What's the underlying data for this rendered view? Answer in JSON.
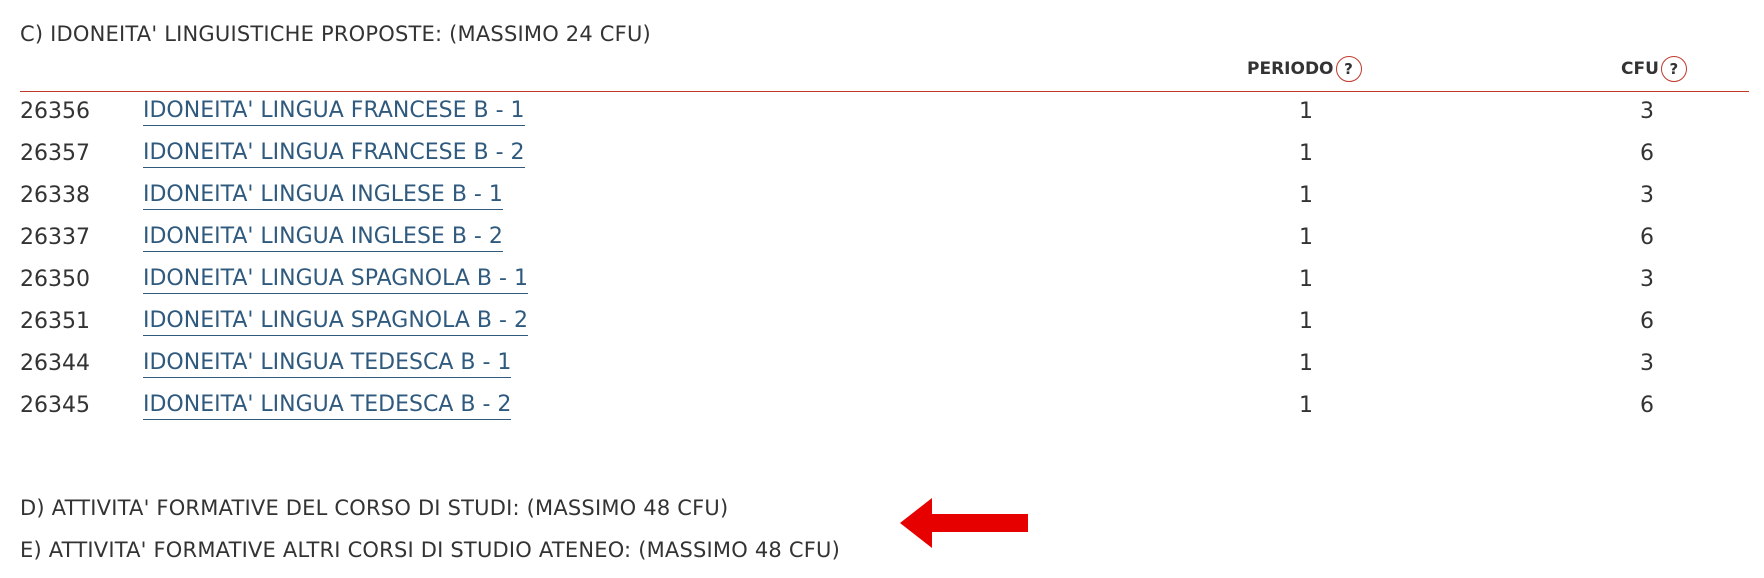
{
  "section_c": {
    "title": "C) IDONEITA' LINGUISTICHE PROPOSTE: (MASSIMO 24 CFU)",
    "headers": {
      "periodo": "PERIODO",
      "cfu": "CFU",
      "help": "?"
    },
    "rows": [
      {
        "code": "26356",
        "name": "IDONEITA' LINGUA FRANCESE B - 1",
        "periodo": "1",
        "cfu": "3"
      },
      {
        "code": "26357",
        "name": "IDONEITA' LINGUA FRANCESE B - 2",
        "periodo": "1",
        "cfu": "6"
      },
      {
        "code": "26338",
        "name": "IDONEITA' LINGUA INGLESE B - 1",
        "periodo": "1",
        "cfu": "3"
      },
      {
        "code": "26337",
        "name": "IDONEITA' LINGUA INGLESE B - 2",
        "periodo": "1",
        "cfu": "6"
      },
      {
        "code": "26350",
        "name": "IDONEITA' LINGUA SPAGNOLA B - 1",
        "periodo": "1",
        "cfu": "3"
      },
      {
        "code": "26351",
        "name": "IDONEITA' LINGUA SPAGNOLA B - 2",
        "periodo": "1",
        "cfu": "6"
      },
      {
        "code": "26344",
        "name": "IDONEITA' LINGUA TEDESCA B - 1",
        "periodo": "1",
        "cfu": "3"
      },
      {
        "code": "26345",
        "name": "IDONEITA' LINGUA TEDESCA B - 2",
        "periodo": "1",
        "cfu": "6"
      }
    ]
  },
  "section_d": {
    "title": "D) ATTIVITA' FORMATIVE DEL CORSO DI STUDI: (MASSIMO 48 CFU)"
  },
  "section_e": {
    "title": "E) ATTIVITA' FORMATIVE ALTRI CORSI DI STUDIO ATENEO: (MASSIMO 48 CFU)"
  },
  "annotation": {
    "icon": "left-arrow-icon",
    "color": "#e60000"
  },
  "colors": {
    "link": "#2f5a7e",
    "accent": "#c0392b",
    "text": "#333333"
  }
}
